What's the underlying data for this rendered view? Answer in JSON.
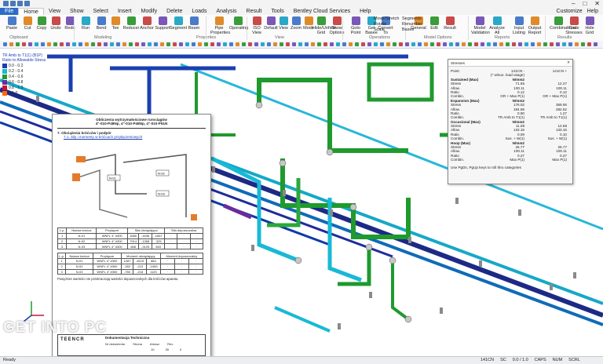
{
  "window": {
    "controls": [
      "–",
      "□",
      "✕"
    ]
  },
  "menu": {
    "file": "File",
    "tabs": [
      "Home",
      "View",
      "Show",
      "Select",
      "Insert",
      "Modify",
      "Delete",
      "Loads",
      "Analysis",
      "Result",
      "Tools",
      "Bentley Cloud Services",
      "Help"
    ],
    "active": "Home",
    "customize": "Customize",
    "help": "Help"
  },
  "ribbon": {
    "buttons": [
      "Paste",
      "Cut",
      "Copy",
      "Undo",
      "Redo",
      "Run",
      "Bend",
      "Tee",
      "Reducer",
      "Anchor",
      "Support",
      "Segment",
      "Beam",
      "Pipe Properties",
      "Operating",
      "ISO View",
      "Default",
      "View",
      "Zoom",
      "Mode",
      "Hide/Unhide Grid",
      "Show Options",
      "Goto Point",
      "Get Basee",
      "Convert To",
      "General",
      "Edit",
      "Result",
      "Model Validation",
      "Analyze All",
      "Input Listing",
      "Output Report",
      "Combinations",
      "Code Stresses",
      "Hide Grid"
    ],
    "small": [
      "Move/Stretch",
      "Rotate",
      "Scale",
      "Segments",
      "Renumber",
      "Bases"
    ],
    "groups": [
      "Clipboard",
      "Modeling",
      "Properties",
      "View",
      "Operations",
      "Model Options",
      "Reports",
      "Results"
    ]
  },
  "legend": {
    "title": "TR Amb to T1(1) (B1P)",
    "subtitle": "Ratio to Allowable Stress",
    "items": [
      {
        "label": "0.0 - 0.2",
        "color": "#1a3fb0"
      },
      {
        "label": "0.2 - 0.4",
        "color": "#18b9d6"
      },
      {
        "label": "0.4 - 0.6",
        "color": "#1e9a2e"
      },
      {
        "label": "0.6 - 0.8",
        "color": "#6a2c9a"
      },
      {
        "label": "0.8 - 1.0",
        "color": "#c8123a"
      },
      {
        "label": "> 1.0",
        "color": "#ff6a00"
      }
    ]
  },
  "stress": {
    "title": "Stresses",
    "point": "Point:",
    "point_a": "141CN -",
    "point_b": "141CN +",
    "units": "(* w/suo. load usage)",
    "rows": [
      [
        "Sustained (Max)",
        "N/mm2",
        ""
      ],
      [
        "Stress",
        "71.55",
        "12.27"
      ],
      [
        "Allow.",
        "100.11",
        "100.11"
      ],
      [
        "Ratio",
        "0.12",
        "0.12"
      ],
      [
        "Combin.",
        "GR + Max P(1)",
        "GR + Max P(1)"
      ],
      [
        "Expansion (Max)",
        "N/mm2",
        ""
      ],
      [
        "Stress",
        "176.02",
        "359.06"
      ],
      [
        "Allow.",
        "194.68",
        "282.52"
      ],
      [
        "Ratio",
        "0.90",
        "1.27"
      ],
      [
        "Combin.",
        "TR Amb to T1(1)",
        "TR Amb to T1(1)"
      ],
      [
        "Occasional (Max)",
        "N/mm2",
        ""
      ],
      [
        "Stress",
        "11.08",
        "12.68"
      ],
      [
        "Allow.",
        "133.15",
        "133.15"
      ],
      [
        "Ratio",
        "0.09",
        "0.10"
      ],
      [
        "Combin.",
        "Sus. + W(1)",
        "Sus. + W(1)"
      ],
      [
        "Hoop (Max)",
        "N/mm2",
        ""
      ],
      [
        "Stress",
        "26.77",
        "26.77"
      ],
      [
        "Allow.",
        "100.11",
        "100.11"
      ],
      [
        "Ratio",
        "0.27",
        "0.27"
      ],
      [
        "Combin.",
        "Max P(1)",
        "Max P(1)"
      ]
    ],
    "hint": "Use PgDn, PgUp keys to roll thru categories"
  },
  "doc": {
    "title": "Obliczenia wytrzymałościowe rurociągów",
    "subtitle": "4\"-010-P48Np, 4\"-010-P48Np, 4\"-010-P51N",
    "section": "7. Obciążenia króćców i podpór",
    "subsection": "7.1. Siły i momenty w króćcach przyłączeniowych",
    "labels": [
      "N-01",
      "N-02",
      "N-03"
    ],
    "t1_head": [
      "L.p.",
      "Nazwa króćca",
      "Przyłącze",
      "Siła obciążająca",
      "Siła dopuszczalna"
    ],
    "t1_rows": [
      [
        "1",
        "N-01",
        "WNFL 4\" #300",
        "1680",
        "-1636",
        "-1667"
      ],
      [
        "2",
        "N-02",
        "WNFL 4\" #300",
        "7914",
        "-1368",
        "-325"
      ],
      [
        "3",
        "N-03",
        "WNFL 4\" #300",
        "668",
        "-3193",
        "563"
      ]
    ],
    "t2_head": [
      "L.p.",
      "Nazwa króćca",
      "Przyłącze",
      "Moment obciążający",
      "Moment dopuszczalny"
    ],
    "t2_rows": [
      [
        "1",
        "N-01",
        "WNFL 4\" #300",
        "1287",
        "-8119",
        "864"
      ],
      [
        "2",
        "N-02",
        "WNFL 4\" #300",
        "-282",
        "-213",
        "-1083"
      ],
      [
        "3",
        "N-03",
        "WNFL 4\" #300",
        "-750",
        "-216",
        "1120"
      ]
    ],
    "note": "Powyższe wartości nie przekraczają wartości dopuszczalnych dla króćców aparatu.",
    "footer_title": "Dokumentacja Techniczna",
    "footer_cols": [
      "Nr dokumentu",
      "Strona",
      "Arkusz",
      "Rev."
    ],
    "footer_vals": [
      "",
      "10",
      "28",
      "0"
    ],
    "company": "TEENCR"
  },
  "watermark": "GET INTO PC",
  "status": {
    "left": "Ready",
    "items": [
      "141CN",
      "SC",
      "0.0 / 1.0",
      "CAPS",
      "NUM",
      "SCRL"
    ]
  }
}
